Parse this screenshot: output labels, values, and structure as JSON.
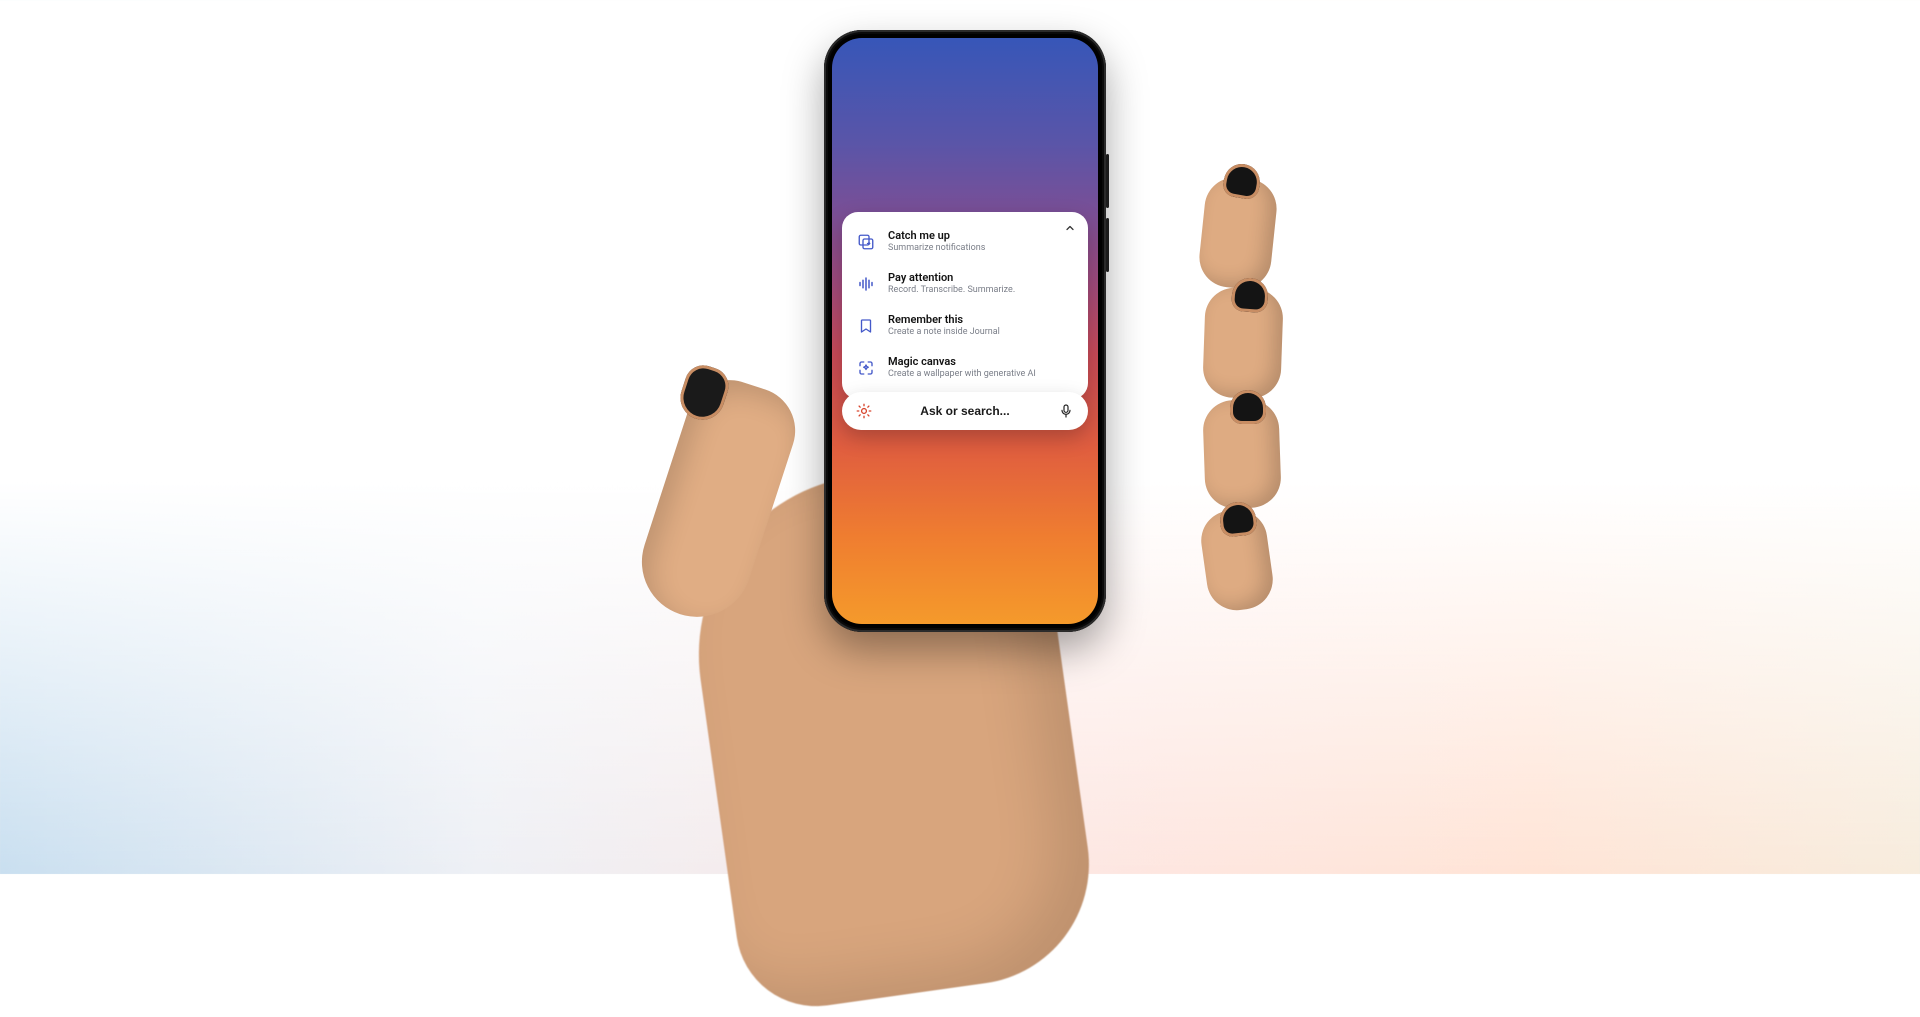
{
  "suggestions": {
    "items": [
      {
        "title": "Catch me up",
        "sub": "Summarize notifications",
        "icon": "stack-refresh-icon"
      },
      {
        "title": "Pay attention",
        "sub": "Record. Transcribe. Summarize.",
        "icon": "waveform-icon"
      },
      {
        "title": "Remember this",
        "sub": "Create a note inside Journal",
        "icon": "bookmark-icon"
      },
      {
        "title": "Magic canvas",
        "sub": "Create a wallpaper with generative AI",
        "icon": "sparkle-frame-icon"
      }
    ]
  },
  "search": {
    "placeholder": "Ask or search..."
  },
  "colors": {
    "iconAccent": "#4459c9",
    "settingsAccent": "#d8462e"
  }
}
